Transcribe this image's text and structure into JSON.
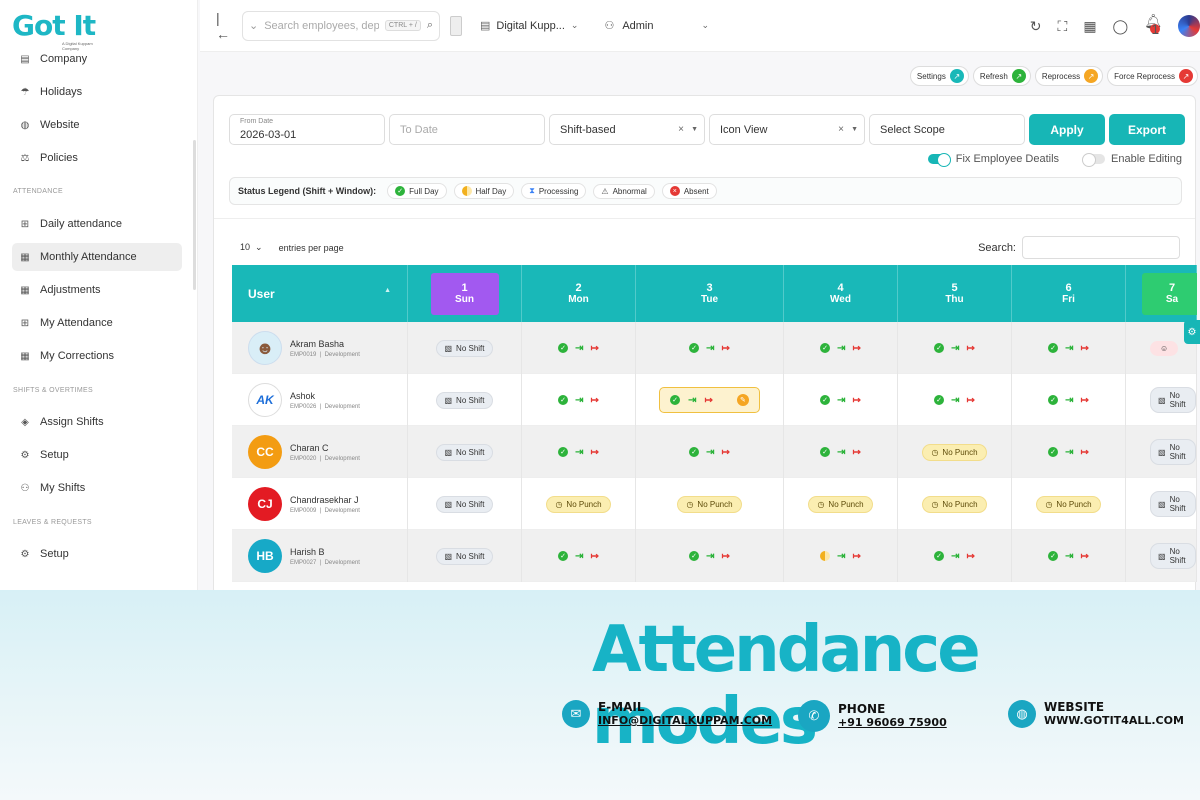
{
  "brand": {
    "logo_text": "Got It",
    "tagline": "A Digital Kuppam Company"
  },
  "topbar": {
    "search_placeholder": "Search employees, departments",
    "search_shortcut": "CTRL + /",
    "org_name": "Digital Kupp...",
    "user_role": "Admin",
    "notification_count": "1"
  },
  "sidebar": {
    "items_top": [
      {
        "label": "Company",
        "icon": "building-icon"
      },
      {
        "label": "Holidays",
        "icon": "umbrella-icon"
      },
      {
        "label": "Website",
        "icon": "globe-icon"
      },
      {
        "label": "Policies",
        "icon": "gavel-icon"
      }
    ],
    "section_attendance": "ATTENDANCE",
    "items_attendance": [
      {
        "label": "Daily attendance",
        "icon": "plus-square-icon"
      },
      {
        "label": "Monthly Attendance",
        "icon": "calendar-icon",
        "active": true
      },
      {
        "label": "Adjustments",
        "icon": "calendar-edit-icon"
      },
      {
        "label": "My Attendance",
        "icon": "plus-square-icon"
      },
      {
        "label": "My Corrections",
        "icon": "calendar-check-icon"
      }
    ],
    "section_shifts": "SHIFTS & OVERTIMES",
    "items_shifts": [
      {
        "label": "Assign Shifts",
        "icon": "diamond-icon"
      },
      {
        "label": "Setup",
        "icon": "gear-icon"
      },
      {
        "label": "My Shifts",
        "icon": "user-icon"
      }
    ],
    "section_leaves": "LEAVES & REQUESTS",
    "items_leaves": [
      {
        "label": "Setup",
        "icon": "gear-icon"
      }
    ]
  },
  "actions": {
    "settings": "Settings",
    "refresh": "Refresh",
    "reprocess": "Reprocess",
    "force_reprocess": "Force Reprocess"
  },
  "filters": {
    "from_date_label": "From Date",
    "from_date_value": "2026-03-01",
    "to_date_placeholder": "To Date",
    "mode": "Shift-based",
    "view": "Icon View",
    "scope": "Select Scope",
    "apply": "Apply",
    "export": "Export",
    "fix_details": "Fix Employee Deatils",
    "enable_editing": "Enable Editing"
  },
  "legend": {
    "title": "Status Legend (Shift + Window):",
    "items": [
      "Full Day",
      "Half Day",
      "Processing",
      "Abnormal",
      "Absent"
    ]
  },
  "table_controls": {
    "entries_value": "10",
    "entries_label": "entries per page",
    "search_label": "Search:"
  },
  "table": {
    "user_header": "User",
    "days": [
      {
        "n": "1",
        "d": "Sun"
      },
      {
        "n": "2",
        "d": "Mon"
      },
      {
        "n": "3",
        "d": "Tue"
      },
      {
        "n": "4",
        "d": "Wed"
      },
      {
        "n": "5",
        "d": "Thu"
      },
      {
        "n": "6",
        "d": "Fri"
      },
      {
        "n": "7",
        "d": "Sa"
      }
    ],
    "no_shift": "No Shift",
    "no_punch": "No Punch",
    "rows": [
      {
        "name": "Akram Basha",
        "emp": "EMP0019",
        "dept": "Development",
        "initials": ""
      },
      {
        "name": "Ashok",
        "emp": "EMP0026",
        "dept": "Development",
        "initials": "AK"
      },
      {
        "name": "Charan C",
        "emp": "EMP0020",
        "dept": "Development",
        "initials": "CC"
      },
      {
        "name": "Chandrasekhar J",
        "emp": "EMP0009",
        "dept": "Development",
        "initials": "CJ"
      },
      {
        "name": "Harish B",
        "emp": "EMP0027",
        "dept": "Development",
        "initials": "HB"
      }
    ]
  },
  "banner": {
    "headline": "Attendance modes",
    "email_title": "E-MAIL",
    "email_value": "INFO@DIGITALKUPPAM.COM",
    "phone_title": "PHONE",
    "phone_value": "+91 96069 75900",
    "website_title": "WEBSITE",
    "website_value": "WWW.GOTIT4ALL.COM"
  },
  "colors": {
    "accent": "#19b8b8",
    "today": "#a259f0",
    "saturday": "#2ecc71",
    "full_day": "#2db33b",
    "absent": "#e53935",
    "no_punch": "#fbeeb1"
  }
}
